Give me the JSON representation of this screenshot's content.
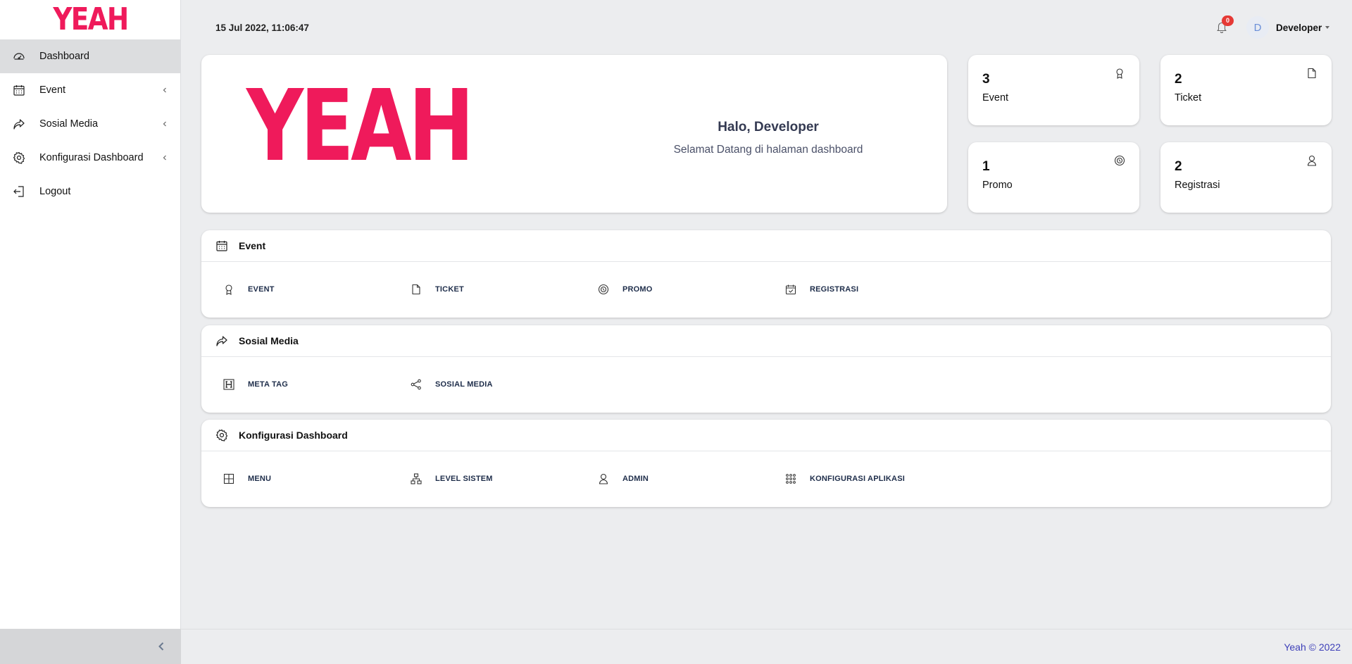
{
  "brand": {
    "logo_text": "YEAH",
    "accent": "#ef1a5b"
  },
  "sidebar": {
    "items": [
      {
        "label": "Dashboard",
        "icon": "speedometer-icon",
        "active": true
      },
      {
        "label": "Event",
        "icon": "calendar-icon",
        "expandable": true
      },
      {
        "label": "Sosial Media",
        "icon": "share-arrow-icon",
        "expandable": true
      },
      {
        "label": "Konfigurasi Dashboard",
        "icon": "gear-icon",
        "expandable": true
      },
      {
        "label": "Logout",
        "icon": "logout-icon"
      }
    ]
  },
  "topbar": {
    "datetime": "15 Jul 2022, 11:06:47",
    "notification_count": "0",
    "avatar_initial": "D",
    "user_name": "Developer"
  },
  "welcome": {
    "logo_text": "YEAH",
    "greeting": "Halo, Developer",
    "subtitle": "Selamat Datang di halaman dashboard"
  },
  "stats": [
    {
      "value": "3",
      "label": "Event",
      "icon": "award-icon"
    },
    {
      "value": "2",
      "label": "Ticket",
      "icon": "file-icon"
    },
    {
      "value": "1",
      "label": "Promo",
      "icon": "coupon-icon"
    },
    {
      "value": "2",
      "label": "Registrasi",
      "icon": "user-icon"
    }
  ],
  "sections": [
    {
      "title": "Event",
      "icon": "calendar-icon",
      "items": [
        {
          "label": "EVENT",
          "icon": "award-icon"
        },
        {
          "label": "TICKET",
          "icon": "file-icon"
        },
        {
          "label": "PROMO",
          "icon": "coupon-icon"
        },
        {
          "label": "REGISTRASI",
          "icon": "calendar-check-icon"
        }
      ]
    },
    {
      "title": "Sosial Media",
      "icon": "share-arrow-icon",
      "items": [
        {
          "label": "META TAG",
          "icon": "heading-icon"
        },
        {
          "label": "SOSIAL MEDIA",
          "icon": "share-nodes-icon"
        }
      ]
    },
    {
      "title": "Konfigurasi Dashboard",
      "icon": "gear-icon",
      "items": [
        {
          "label": "MENU",
          "icon": "grid-icon"
        },
        {
          "label": "LEVEL SISTEM",
          "icon": "sitemap-icon"
        },
        {
          "label": "ADMIN",
          "icon": "user-icon"
        },
        {
          "label": "KONFIGURASI APLIKASI",
          "icon": "apps-icon"
        }
      ]
    }
  ],
  "footer": {
    "text": "Yeah © 2022",
    "color": "#3d3fb8"
  }
}
